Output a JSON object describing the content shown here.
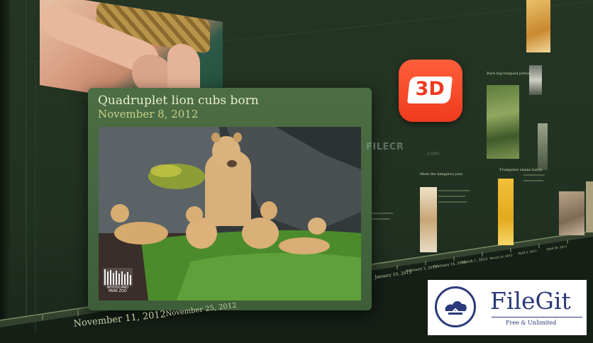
{
  "featured": {
    "title": "Quadruplet lion cubs born",
    "date": "November 8, 2012",
    "logo_text": "WOODLAND PARK ZOO"
  },
  "app_icon": {
    "label": "3D",
    "color": "#ef3a1f"
  },
  "watermark": {
    "name": "FILECR",
    "suffix": ".com"
  },
  "timeline": {
    "labels": [
      "November 11, 2012",
      "November 25, 2012",
      "January 10, 2013",
      "February 2, 2013",
      "February 14, 2013",
      "March 1, 2013",
      "March 14, 2013",
      "April 2, 2013",
      "April 20, 2013"
    ]
  },
  "distant_cards": {
    "card1_title": "Rare big-tongued jerboa",
    "card2_title": "Meet the kangaroo joey",
    "card3_title": "Trumpeter swans hatch"
  },
  "badge": {
    "name": "FileGit",
    "tagline": "Free & Unlimited"
  },
  "colors": {
    "background": "#223222",
    "card": "#4d6e44",
    "title": "#e8eccf",
    "date": "#c8d08a",
    "badge_text": "#2b3a7a"
  }
}
